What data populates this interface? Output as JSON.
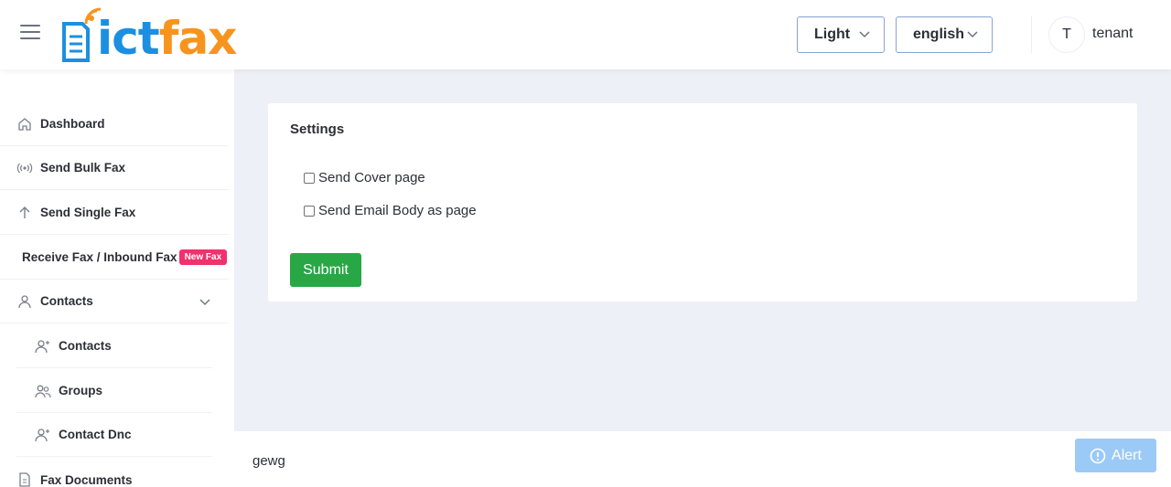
{
  "header": {
    "logo_ict": "ict",
    "logo_fax": "fax",
    "theme_select": "Light",
    "language_select": "english",
    "avatar_initial": "T",
    "user_name": "tenant"
  },
  "sidebar": {
    "items": [
      {
        "label": "Dashboard",
        "icon": "home-icon"
      },
      {
        "label": "Send Bulk Fax",
        "icon": "broadcast-icon"
      },
      {
        "label": "Send Single Fax",
        "icon": "arrow-up-icon"
      },
      {
        "label": "Receive Fax / Inbound Fax",
        "badge": "New Fax"
      },
      {
        "label": "Contacts",
        "icon": "user-icon"
      },
      {
        "label": "Contacts",
        "icon": "user-plus-icon"
      },
      {
        "label": "Groups",
        "icon": "users-icon"
      },
      {
        "label": "Contact Dnc",
        "icon": "user-plus-icon"
      },
      {
        "label": "Fax Documents",
        "icon": "document-icon"
      }
    ]
  },
  "settings": {
    "title": "Settings",
    "options": [
      {
        "label": "Send Cover page",
        "checked": false
      },
      {
        "label": "Send Email Body as page",
        "checked": false
      }
    ],
    "submit_label": "Submit"
  },
  "footer": {
    "text": "gewg",
    "alert_label": "Alert"
  },
  "colors": {
    "brand_blue": "#1d8fe0",
    "brand_orange": "#f7941d",
    "submit_green": "#28a745",
    "badge_pink": "#f0326e",
    "alert_blue": "#9ccaf7"
  }
}
